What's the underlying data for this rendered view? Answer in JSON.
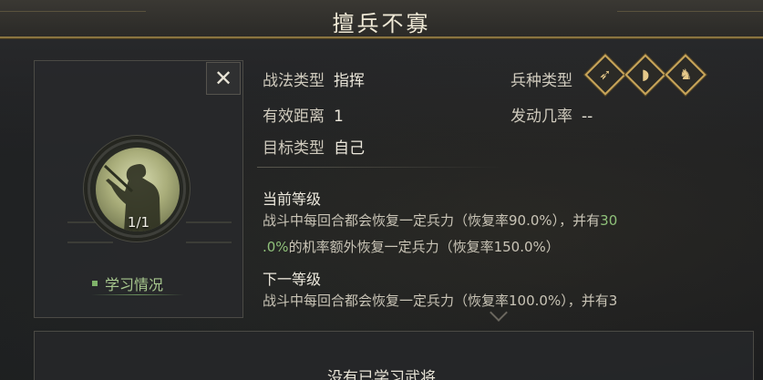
{
  "title": "擅兵不寡",
  "close_symbol": "✕",
  "portrait": {
    "level": "1/1"
  },
  "learn_status": "学习情况",
  "info": {
    "tactic_type_label": "战法类型",
    "tactic_type_value": "指挥",
    "range_label": "有效距离",
    "range_value": "1",
    "target_label": "目标类型",
    "target_value": "自己",
    "troop_type_label": "兵种类型",
    "trigger_rate_label": "发动几率",
    "trigger_rate_value": "--"
  },
  "troop_icons": [
    "bow-icon",
    "shield-icon",
    "horse-icon"
  ],
  "current_level": {
    "title": "当前等级",
    "line1_a": "战斗中每回合都会恢复一定兵力（恢复率90.0%），并有",
    "line1_hl": "30",
    "line2_hl": ".0%",
    "line2_a": "的机率额外恢复一定兵力（恢复率150.0%）"
  },
  "next_level": {
    "title": "下一等级",
    "line1": "战斗中每回合都会恢复一定兵力（恢复率100.0%），并有3"
  },
  "bottom_text": "没有已学习武将",
  "colors": {
    "accent_gold": "#c8a55a",
    "highlight_green": "#8fc17a"
  }
}
